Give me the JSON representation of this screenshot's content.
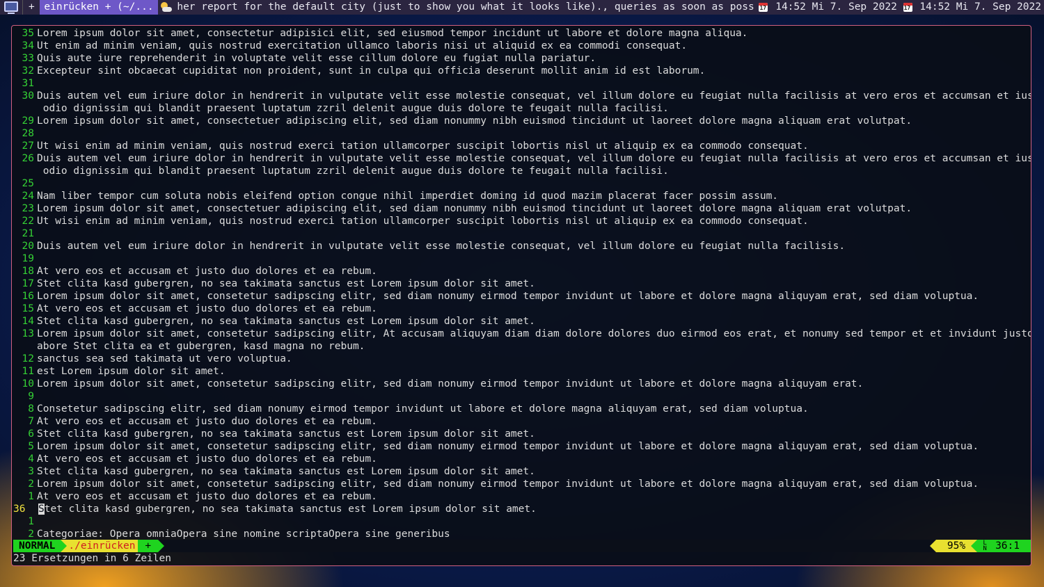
{
  "topbar": {
    "computer_icon": "computer-icon",
    "plus_label": "+",
    "active_tab": "einrücken + (~/...",
    "weather_icon": "partly-cloudy-icon",
    "weather_text": "her report for the default city (just to show you what it looks like)., queries as soon as poss",
    "calendar_icon": "calendar-icon",
    "calendar_day": "17",
    "clock1": "14:52 Mi  7. Sep 2022",
    "clock2": "14:52 Mi  7. Sep 2022"
  },
  "editor": {
    "lines": [
      {
        "n": "35",
        "t": "Lorem ipsum dolor sit amet, consectetur adipisici elit, sed eiusmod tempor incidunt ut labore et dolore magna aliqua."
      },
      {
        "n": "34",
        "t": "Ut enim ad minim veniam, quis nostrud exercitation ullamco laboris nisi ut aliquid ex ea commodi consequat."
      },
      {
        "n": "33",
        "t": "Quis aute iure reprehenderit in voluptate velit esse cillum dolore eu fugiat nulla pariatur."
      },
      {
        "n": "32",
        "t": "Excepteur sint obcaecat cupiditat non proident, sunt in culpa qui officia deserunt mollit anim id est laborum."
      },
      {
        "n": "31",
        "t": ""
      },
      {
        "n": "30",
        "t": "Duis autem vel eum iriure dolor in hendrerit in vulputate velit esse molestie consequat, vel illum dolore eu feugiat nulla facilisis at vero eros et accumsan et iusto"
      },
      {
        "n": "",
        "t": " odio dignissim qui blandit praesent luptatum zzril delenit augue duis dolore te feugait nulla facilisi."
      },
      {
        "n": "29",
        "t": "Lorem ipsum dolor sit amet, consectetuer adipiscing elit, sed diam nonummy nibh euismod tincidunt ut laoreet dolore magna aliquam erat volutpat."
      },
      {
        "n": "28",
        "t": ""
      },
      {
        "n": "27",
        "t": "Ut wisi enim ad minim veniam, quis nostrud exerci tation ullamcorper suscipit lobortis nisl ut aliquip ex ea commodo consequat."
      },
      {
        "n": "26",
        "t": "Duis autem vel eum iriure dolor in hendrerit in vulputate velit esse molestie consequat, vel illum dolore eu feugiat nulla facilisis at vero eros et accumsan et iusto"
      },
      {
        "n": "",
        "t": " odio dignissim qui blandit praesent luptatum zzril delenit augue duis dolore te feugait nulla facilisi."
      },
      {
        "n": "25",
        "t": ""
      },
      {
        "n": "24",
        "t": "Nam liber tempor cum soluta nobis eleifend option congue nihil imperdiet doming id quod mazim placerat facer possim assum."
      },
      {
        "n": "23",
        "t": "Lorem ipsum dolor sit amet, consectetuer adipiscing elit, sed diam nonummy nibh euismod tincidunt ut laoreet dolore magna aliquam erat volutpat."
      },
      {
        "n": "22",
        "t": "Ut wisi enim ad minim veniam, quis nostrud exerci tation ullamcorper suscipit lobortis nisl ut aliquip ex ea commodo consequat."
      },
      {
        "n": "21",
        "t": ""
      },
      {
        "n": "20",
        "t": "Duis autem vel eum iriure dolor in hendrerit in vulputate velit esse molestie consequat, vel illum dolore eu feugiat nulla facilisis."
      },
      {
        "n": "19",
        "t": ""
      },
      {
        "n": "18",
        "t": "At vero eos et accusam et justo duo dolores et ea rebum."
      },
      {
        "n": "17",
        "t": "Stet clita kasd gubergren, no sea takimata sanctus est Lorem ipsum dolor sit amet."
      },
      {
        "n": "16",
        "t": "Lorem ipsum dolor sit amet, consetetur sadipscing elitr, sed diam nonumy eirmod tempor invidunt ut labore et dolore magna aliquyam erat, sed diam voluptua."
      },
      {
        "n": "15",
        "t": "At vero eos et accusam et justo duo dolores et ea rebum."
      },
      {
        "n": "14",
        "t": "Stet clita kasd gubergren, no sea takimata sanctus est Lorem ipsum dolor sit amet."
      },
      {
        "n": "13",
        "t": "Lorem ipsum dolor sit amet, consetetur sadipscing elitr, At accusam aliquyam diam diam dolore dolores duo eirmod eos erat, et nonumy sed tempor et et invidunt justo l"
      },
      {
        "n": "",
        "t": "abore Stet clita ea et gubergren, kasd magna no rebum."
      },
      {
        "n": "12",
        "t": "sanctus sea sed takimata ut vero voluptua."
      },
      {
        "n": "11",
        "t": "est Lorem ipsum dolor sit amet."
      },
      {
        "n": "10",
        "t": "Lorem ipsum dolor sit amet, consetetur sadipscing elitr, sed diam nonumy eirmod tempor invidunt ut labore et dolore magna aliquyam erat."
      },
      {
        "n": "9",
        "t": ""
      },
      {
        "n": "8",
        "t": "Consetetur sadipscing elitr, sed diam nonumy eirmod tempor invidunt ut labore et dolore magna aliquyam erat, sed diam voluptua."
      },
      {
        "n": "7",
        "t": "At vero eos et accusam et justo duo dolores et ea rebum."
      },
      {
        "n": "6",
        "t": "Stet clita kasd gubergren, no sea takimata sanctus est Lorem ipsum dolor sit amet."
      },
      {
        "n": "5",
        "t": "Lorem ipsum dolor sit amet, consetetur sadipscing elitr, sed diam nonumy eirmod tempor invidunt ut labore et dolore magna aliquyam erat, sed diam voluptua."
      },
      {
        "n": "4",
        "t": "At vero eos et accusam et justo duo dolores et ea rebum."
      },
      {
        "n": "3",
        "t": "Stet clita kasd gubergren, no sea takimata sanctus est Lorem ipsum dolor sit amet."
      },
      {
        "n": "2",
        "t": "Lorem ipsum dolor sit amet, consetetur sadipscing elitr, sed diam nonumy eirmod tempor invidunt ut labore et dolore magna aliquyam erat, sed diam voluptua."
      },
      {
        "n": "1",
        "t": "At vero eos et accusam et justo duo dolores et ea rebum."
      },
      {
        "n": "36",
        "t": "Stet clita kasd gubergren, no sea takimata sanctus est Lorem ipsum dolor sit amet.",
        "current": true
      },
      {
        "n": "1",
        "t": ""
      },
      {
        "n": "2",
        "t": "Categoriae: Opera omniaOpera sine nomine scriptaOpera sine generibus"
      }
    ]
  },
  "statusline": {
    "mode": "NORMAL",
    "file": "./einrücken",
    "modified": "+",
    "percent": "95%",
    "ln_symbol_top": "L",
    "ln_symbol_bottom": "N",
    "position": "36:1"
  },
  "message": "23 Ersetzungen in 6 Zeilen",
  "colors": {
    "line_number": "#35d135",
    "mode_bg": "#1fd31f",
    "file_bg": "#e8e030",
    "file_fg": "#d02020",
    "window_border": "#d06080",
    "topbar_active": "#6e58c8"
  }
}
